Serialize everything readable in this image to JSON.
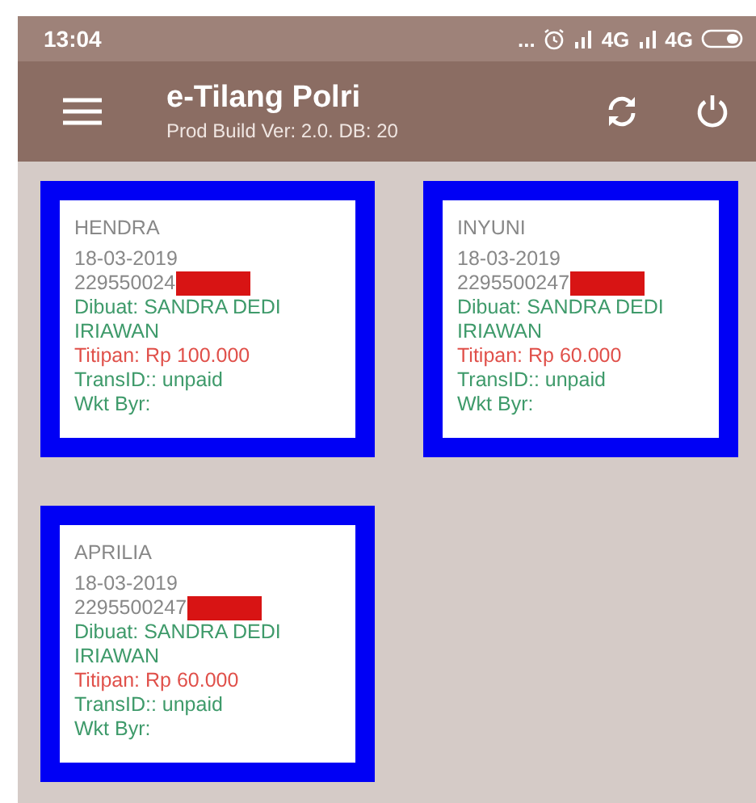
{
  "status_bar": {
    "time": "13:04",
    "indicators": "...",
    "network_1": "4G",
    "network_2": "4G"
  },
  "app_bar": {
    "title": "e-Tilang Polri",
    "subtitle": "Prod Build Ver: 2.0. DB: 20"
  },
  "cards": [
    {
      "name": "HENDRA",
      "date": "18-03-2019",
      "number": "229550024",
      "redacted": true,
      "creator": "Dibuat: SANDRA DEDI IRIAWAN",
      "deposit": "Titipan: Rp 100.000",
      "trans_id": "TransID:: unpaid",
      "payment_time": "Wkt Byr:"
    },
    {
      "name": "INYUNI",
      "date": "18-03-2019",
      "number": "2295500247",
      "redacted": true,
      "creator": "Dibuat: SANDRA DEDI IRIAWAN",
      "deposit": "Titipan: Rp 60.000",
      "trans_id": "TransID:: unpaid",
      "payment_time": "Wkt Byr:"
    },
    {
      "name": "APRILIA",
      "date": "18-03-2019",
      "number": "2295500247",
      "redacted": true,
      "creator": "Dibuat: SANDRA DEDI IRIAWAN",
      "deposit": "Titipan: Rp 60.000",
      "trans_id": "TransID:: unpaid",
      "payment_time": "Wkt Byr:"
    }
  ]
}
